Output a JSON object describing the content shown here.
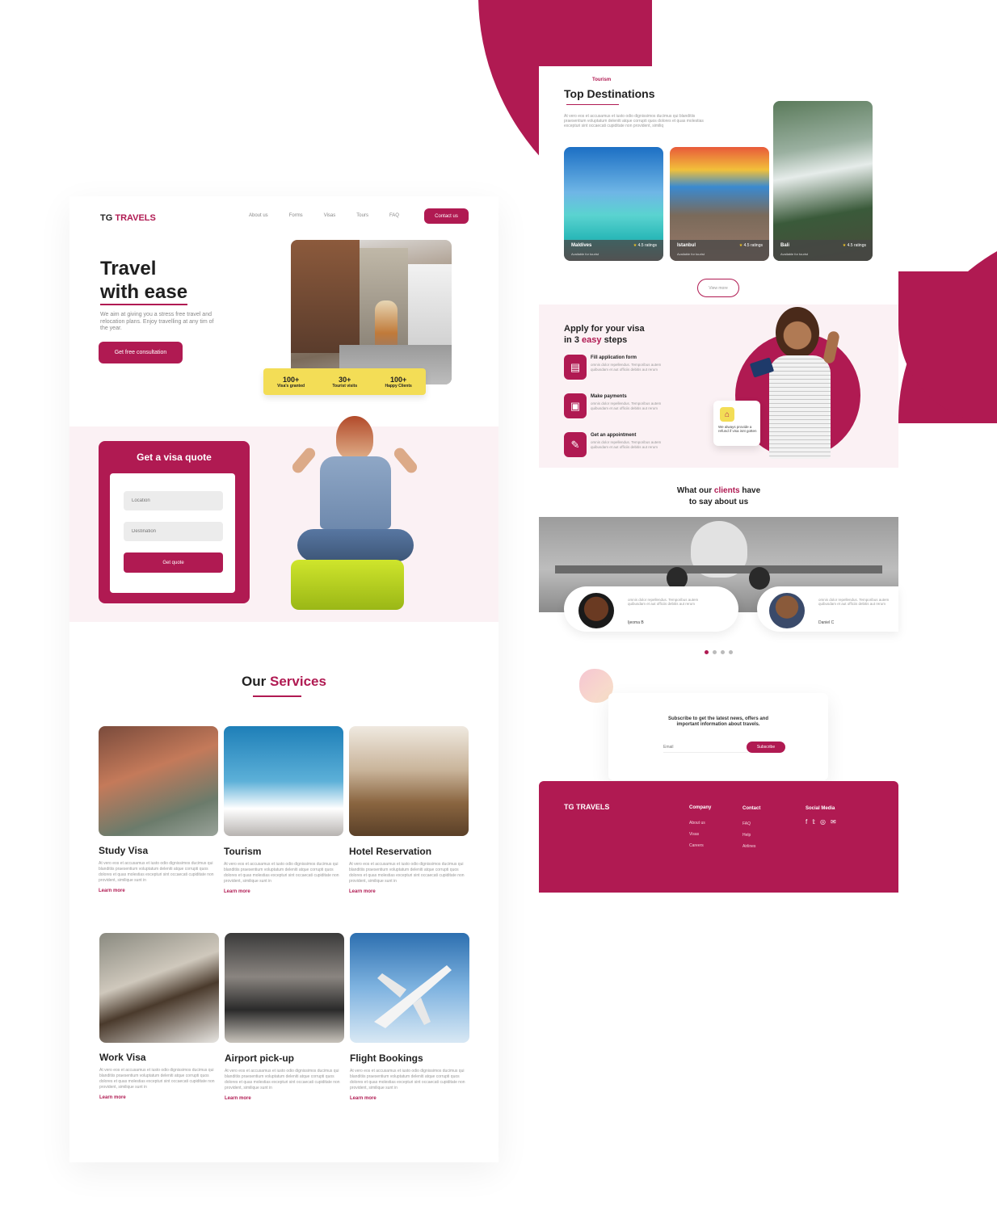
{
  "colors": {
    "accent": "#b01a52",
    "accent_soft": "#fbf1f4",
    "yellow": "#f3dd56"
  },
  "left": {
    "brand_prefix": "TG",
    "brand_suffix": "TRAVELS",
    "nav": [
      "About us",
      "Forms",
      "Visas",
      "Tours",
      "FAQ"
    ],
    "contact_label": "Contact us",
    "hero": {
      "title_line1": "Travel",
      "title_line2": "with ease",
      "subtitle": "We aim at giving you a stress free travel and relocation plans. Enjoy travelling at any tim of the year.",
      "cta": "Get free consultation",
      "stats": [
        {
          "value": "100+",
          "label": "Visa's granted"
        },
        {
          "value": "30+",
          "label": "Tourist visits"
        },
        {
          "value": "100+",
          "label": "Happy Clients"
        }
      ]
    },
    "quote": {
      "title": "Get a visa quote",
      "location_placeholder": "Location",
      "destination_placeholder": "Destination",
      "button": "Get quote"
    },
    "services": {
      "heading_prefix": "Our",
      "heading_highlight": "Services",
      "body": "At vero eos et accusamus et iusto odio dignissimos ducimus qui blanditiis praesentium voluptatum deleniti atque corrupti quos dolores et quas molestias excepturi sint occaecati cupiditate non provident, similique sunt in",
      "learn_more": "Learn more",
      "items": [
        "Study Visa",
        "Tourism",
        "Hotel Reservation",
        "Work Visa",
        "Airport pick-up",
        "Flight Bookings"
      ]
    }
  },
  "right": {
    "destinations": {
      "eyebrow": "Tourism",
      "title": "Top Destinations",
      "body": "At vero eos et accusamus et iusto odio dignissimos ducimus qui blanditiis praesentium voluptatum deleniti atque corrupti quos dolores et quas molestias excepturi sint occaecati cupiditate non provident, similiq",
      "cards": [
        {
          "name": "Maldives",
          "rating": "4.5 ratings",
          "sub": "Available for tourist"
        },
        {
          "name": "Istanbul",
          "rating": "4.5 ratings",
          "sub": "Available for tourist"
        },
        {
          "name": "Bali",
          "rating": "4.5 ratings",
          "sub": "Available for tourist"
        }
      ],
      "view_more": "View more"
    },
    "visa": {
      "title_line1": "Apply for your visa",
      "title_line2_prefix": "in 3",
      "title_line2_highlight": "easy",
      "title_line2_suffix": "steps",
      "step_body": "omnis dolor repellendus. Temporibus autem quibusdam et aut officiis debitis aut rerum",
      "steps": [
        "Fill application form",
        "Make payments",
        "Get an appointment"
      ],
      "refund_note": "We always provide a refund if visa isnt gotten"
    },
    "testimonials": {
      "title_prefix": "What our",
      "title_highlight": "clients",
      "title_suffix": "have",
      "title_line2": "to say about us",
      "body": "omnis dolor repellendus. Temporibus autem quibusdam et aut officiis debitis aut rerum",
      "clients": [
        "Ijeoma B",
        "Daniel C"
      ]
    },
    "subscribe": {
      "text": "Subscribe to get the latest news, offers and important information about travels.",
      "placeholder": "Email",
      "button": "Subscribe"
    },
    "footer": {
      "brand": "TG TRAVELS",
      "company_title": "Company",
      "company": [
        "About us",
        "Visas",
        "Careers"
      ],
      "contact_title": "Contact",
      "contact": [
        "FAQ",
        "Help",
        "Airlines"
      ],
      "social_title": "Social Media",
      "social_icons": [
        "facebook-icon",
        "twitter-icon",
        "instagram-icon",
        "mail-icon"
      ]
    }
  }
}
